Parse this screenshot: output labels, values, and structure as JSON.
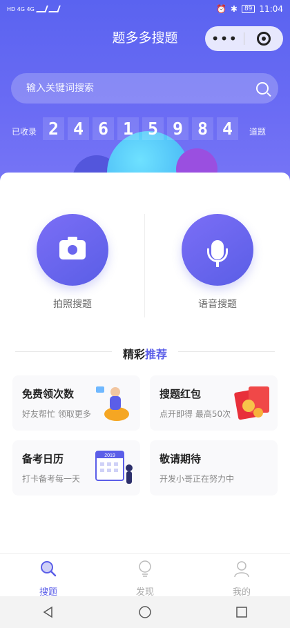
{
  "statusbar": {
    "left": "HD 4G 4G",
    "battery": "89",
    "time": "11:04"
  },
  "header": {
    "title": "题多多搜题"
  },
  "search": {
    "placeholder": "输入关键词搜索"
  },
  "counter": {
    "prefix": "已收录",
    "digits": [
      "2",
      "4",
      "6",
      "1",
      "5",
      "9",
      "8",
      "4"
    ],
    "suffix": "道题"
  },
  "modes": [
    {
      "label": "拍照搜题",
      "icon": "camera-icon"
    },
    {
      "label": "语音搜题",
      "icon": "microphone-icon"
    }
  ],
  "section": {
    "title_part1": "精彩",
    "title_part2": "推荐"
  },
  "features": [
    {
      "title": "免费领次数",
      "subtitle": "好友帮忙 领取更多",
      "icon": "person-sitting-illustration"
    },
    {
      "title": "搜题红包",
      "subtitle": "点开即得 最高50次",
      "icon": "red-envelope-illustration"
    },
    {
      "title": "备考日历",
      "subtitle": "打卡备考每一天",
      "icon": "calendar-2019-illustration"
    },
    {
      "title": "敬请期待",
      "subtitle": "开发小哥正在努力中",
      "icon": ""
    }
  ],
  "calendar_year": "2019",
  "tabs": [
    {
      "label": "搜题",
      "icon": "search-icon",
      "active": true
    },
    {
      "label": "发现",
      "icon": "lightbulb-icon",
      "active": false
    },
    {
      "label": "我的",
      "icon": "person-icon",
      "active": false
    }
  ],
  "colors": {
    "accent": "#5b5ee8",
    "hero": "#6b6cf4"
  }
}
